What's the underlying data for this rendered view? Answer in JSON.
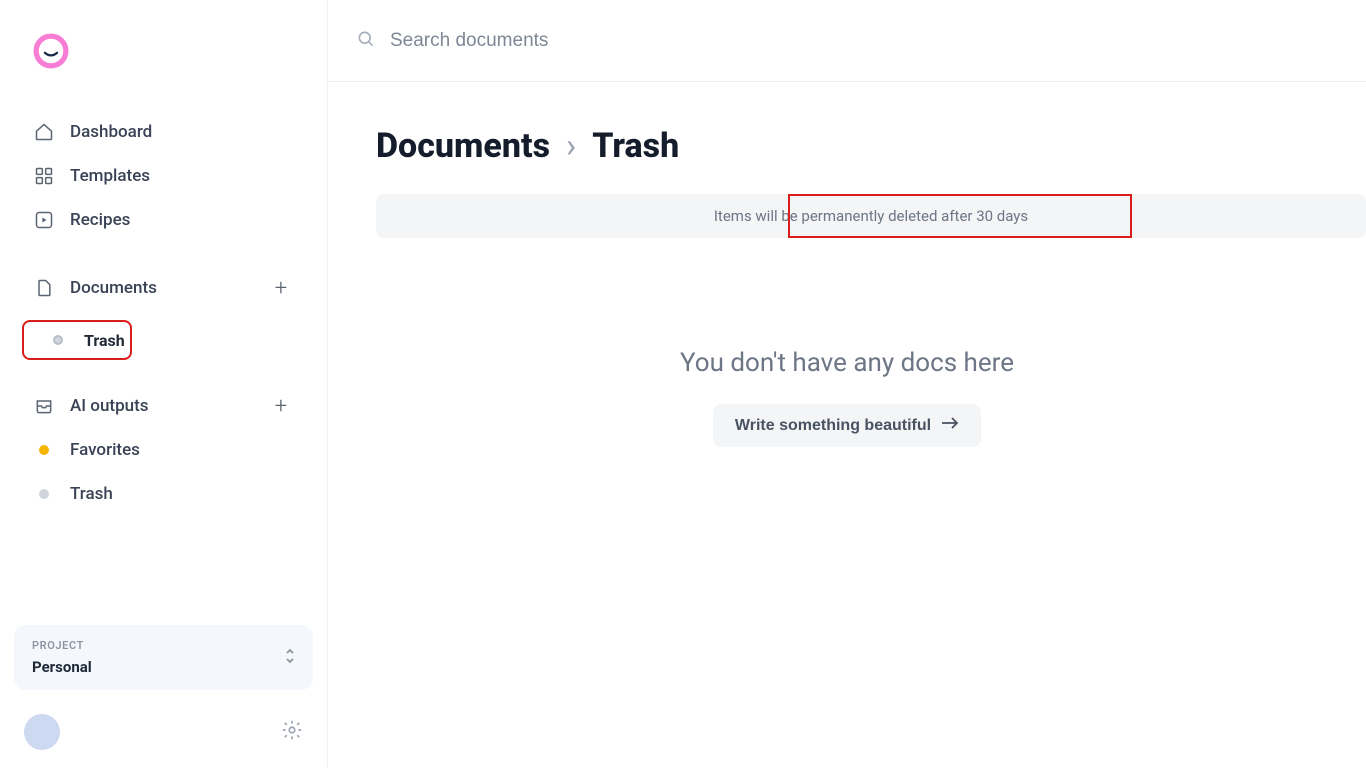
{
  "sidebar": {
    "nav": {
      "dashboard": "Dashboard",
      "templates": "Templates",
      "recipes": "Recipes",
      "documents": "Documents",
      "trash": "Trash",
      "ai_outputs": "AI outputs",
      "favorites": "Favorites",
      "trash2": "Trash"
    },
    "project": {
      "caption": "PROJECT",
      "name": "Personal"
    }
  },
  "search": {
    "placeholder": "Search documents"
  },
  "breadcrumb": {
    "root": "Documents",
    "current": "Trash"
  },
  "banner": {
    "text": "Items will be permanently deleted after 30 days"
  },
  "empty": {
    "message": "You don't have any docs here",
    "cta": "Write something beautiful"
  }
}
